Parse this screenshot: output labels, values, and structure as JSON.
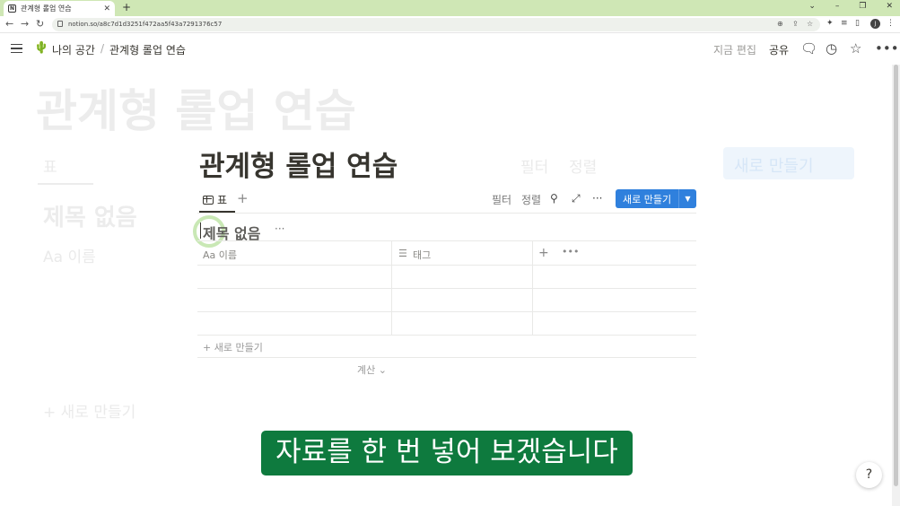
{
  "browser": {
    "tab_title": "관계형 롤업 연습",
    "tab_favicon": "N",
    "tab_close": "✕",
    "new_tab": "+",
    "window_controls": [
      "⌄",
      "–",
      "❐",
      "✕"
    ],
    "url": "notion.so/a8c7d1d3251f472aa5f43a7291376c57",
    "profile_initial": "J"
  },
  "topbar": {
    "breadcrumb_root": "나의 공간",
    "breadcrumb_sep": "/",
    "breadcrumb_page": "관계형 롤업 연습",
    "edited": "지금 편집",
    "share": "공유"
  },
  "ghost": {
    "title": "관계형 롤업 연습",
    "view": "표",
    "filter": "필터",
    "sort": "정렬",
    "new": "새로 만들기",
    "db_title": "제목 없음",
    "col_name": "Aa 이름",
    "new_row": "+ 새로 만들기"
  },
  "page": {
    "title": "관계형 롤업 연습",
    "view_tab": "표",
    "view_add": "+",
    "filter": "필터",
    "sort": "정렬",
    "more": "···",
    "new_button": "새로 만들기",
    "db_title": "제목 없음",
    "db_more": "···",
    "columns": [
      {
        "label": "Aa 이름"
      },
      {
        "label": "태그"
      }
    ],
    "new_row": "새로 만들기",
    "calc": "계산"
  },
  "caption": "자료를 한 번 넣어 보겠습니다",
  "help": "?",
  "colors": {
    "accent": "#2f80dd",
    "caption_bg": "#0e7a3e",
    "chrome": "#cfe7b5"
  }
}
